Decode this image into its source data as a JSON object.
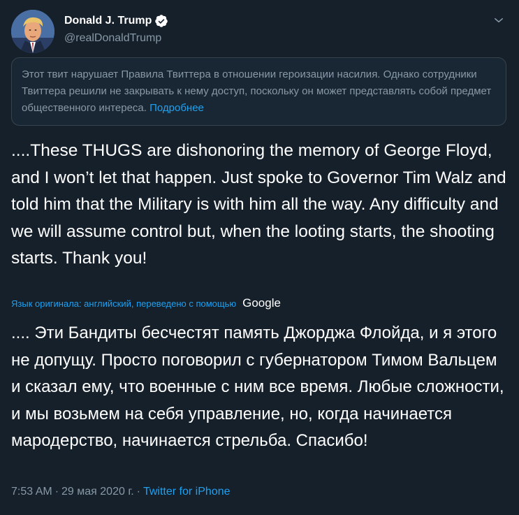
{
  "author": {
    "display_name": "Donald J. Trump",
    "handle": "@realDonaldTrump"
  },
  "icons": {
    "verified": "verified-badge-icon",
    "caret": "chevron-down-icon"
  },
  "notice": {
    "text": "Этот твит нарушает Правила Твиттера в отношении героизации насилия. Однако сотрудники Твиттера решили не закрывать к нему доступ, поскольку он может представлять собой предмет общественного интереса.",
    "link": "Подробнее"
  },
  "tweet": {
    "text": "....These THUGS are dishonoring the memory of George Floyd, and I won’t let that happen. Just spoke to Governor Tim Walz and told him that the Military is with him all the way. Any difficulty and we will assume control but, when the looting starts, the shooting starts. Thank you!"
  },
  "translation": {
    "label": "Язык оригинала: английский, переведено с помощью",
    "provider": "Google",
    "text": ".... Эти Бандиты бесчестят память Джорджа Флойда, и я этого не допущу. Просто поговорил с губернатором Тимом Вальцем и сказал ему, что военные с ним все время. Любые сложности, и мы возьмем на себя управление, но, когда начинается мародерство, начинается стрельба. Спасибо!"
  },
  "meta": {
    "time": "7:53 AM",
    "separator": "·",
    "date": "29 мая 2020 г.",
    "separator2": "·",
    "source": "Twitter for iPhone"
  },
  "colors": {
    "background": "#15202b",
    "accent": "#1da1f2",
    "secondary_text": "#8899a6",
    "border": "#38444d"
  }
}
